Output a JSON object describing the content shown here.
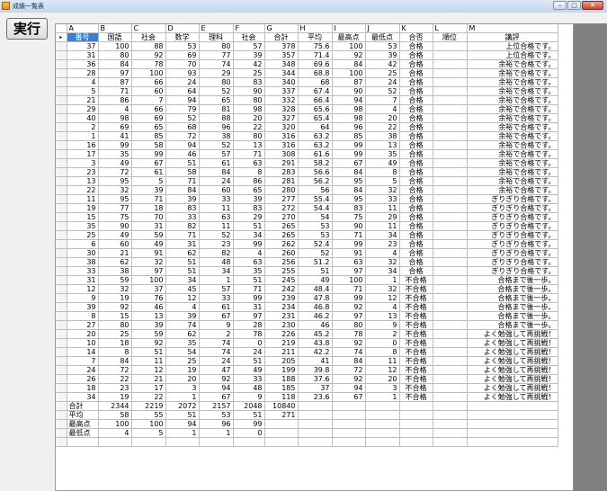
{
  "window": {
    "title": "成績一覧表",
    "min": "–",
    "max": "□",
    "close": "✕"
  },
  "run_button": "実行",
  "columns": [
    "A",
    "B",
    "C",
    "D",
    "E",
    "F",
    "G",
    "H",
    "I",
    "J",
    "K",
    "L",
    "M"
  ],
  "headers": [
    "番号",
    "国語",
    "社会",
    "数学",
    "理科",
    "社会",
    "合計",
    "平均",
    "最高点",
    "最低点",
    "合否",
    "順位",
    "講評"
  ],
  "rows": [
    [
      "37",
      "100",
      "88",
      "53",
      "80",
      "57",
      "378",
      "75.6",
      "100",
      "53",
      "合格",
      "",
      "上位合格です。"
    ],
    [
      "31",
      "80",
      "92",
      "69",
      "77",
      "39",
      "357",
      "71.4",
      "92",
      "39",
      "合格",
      "",
      "上位合格です。"
    ],
    [
      "36",
      "84",
      "78",
      "70",
      "74",
      "42",
      "348",
      "69.6",
      "84",
      "42",
      "合格",
      "",
      "余裕で合格です。"
    ],
    [
      "28",
      "97",
      "100",
      "93",
      "29",
      "25",
      "344",
      "68.8",
      "100",
      "25",
      "合格",
      "",
      "余裕で合格です。"
    ],
    [
      "4",
      "87",
      "66",
      "24",
      "80",
      "83",
      "340",
      "68",
      "87",
      "24",
      "合格",
      "",
      "余裕で合格です。"
    ],
    [
      "5",
      "71",
      "60",
      "64",
      "52",
      "90",
      "337",
      "67.4",
      "90",
      "52",
      "合格",
      "",
      "余裕で合格です。"
    ],
    [
      "21",
      "86",
      "7",
      "94",
      "65",
      "80",
      "332",
      "66.4",
      "94",
      "7",
      "合格",
      "",
      "余裕で合格です。"
    ],
    [
      "29",
      "4",
      "66",
      "79",
      "81",
      "98",
      "328",
      "65.6",
      "98",
      "4",
      "合格",
      "",
      "余裕で合格です。"
    ],
    [
      "40",
      "98",
      "69",
      "52",
      "88",
      "20",
      "327",
      "65.4",
      "98",
      "20",
      "合格",
      "",
      "余裕で合格です。"
    ],
    [
      "2",
      "69",
      "65",
      "68",
      "96",
      "22",
      "320",
      "64",
      "96",
      "22",
      "合格",
      "",
      "余裕で合格です。"
    ],
    [
      "1",
      "41",
      "85",
      "72",
      "38",
      "80",
      "316",
      "63.2",
      "85",
      "38",
      "合格",
      "",
      "余裕で合格です。"
    ],
    [
      "16",
      "99",
      "58",
      "94",
      "52",
      "13",
      "316",
      "63.2",
      "99",
      "13",
      "合格",
      "",
      "余裕で合格です。"
    ],
    [
      "17",
      "35",
      "99",
      "46",
      "57",
      "71",
      "308",
      "61.6",
      "99",
      "35",
      "合格",
      "",
      "余裕で合格です。"
    ],
    [
      "3",
      "49",
      "67",
      "51",
      "61",
      "63",
      "291",
      "58.2",
      "67",
      "49",
      "合格",
      "",
      "余裕で合格です。"
    ],
    [
      "23",
      "72",
      "61",
      "58",
      "84",
      "8",
      "283",
      "56.6",
      "84",
      "8",
      "合格",
      "",
      "余裕で合格です。"
    ],
    [
      "13",
      "95",
      "5",
      "71",
      "24",
      "86",
      "281",
      "56.2",
      "95",
      "5",
      "合格",
      "",
      "余裕で合格です。"
    ],
    [
      "22",
      "32",
      "39",
      "84",
      "60",
      "65",
      "280",
      "56",
      "84",
      "32",
      "合格",
      "",
      "余裕で合格です。"
    ],
    [
      "11",
      "95",
      "71",
      "39",
      "33",
      "39",
      "277",
      "55.4",
      "95",
      "33",
      "合格",
      "",
      "ぎりぎり合格です。"
    ],
    [
      "19",
      "77",
      "18",
      "83",
      "11",
      "83",
      "272",
      "54.4",
      "83",
      "11",
      "合格",
      "",
      "ぎりぎり合格です。"
    ],
    [
      "15",
      "75",
      "70",
      "33",
      "63",
      "29",
      "270",
      "54",
      "75",
      "29",
      "合格",
      "",
      "ぎりぎり合格です。"
    ],
    [
      "35",
      "90",
      "31",
      "82",
      "11",
      "51",
      "265",
      "53",
      "90",
      "11",
      "合格",
      "",
      "ぎりぎり合格です。"
    ],
    [
      "25",
      "49",
      "59",
      "71",
      "52",
      "34",
      "265",
      "53",
      "71",
      "34",
      "合格",
      "",
      "ぎりぎり合格です。"
    ],
    [
      "6",
      "60",
      "49",
      "31",
      "23",
      "99",
      "262",
      "52.4",
      "99",
      "23",
      "合格",
      "",
      "ぎりぎり合格です。"
    ],
    [
      "30",
      "21",
      "91",
      "62",
      "82",
      "4",
      "260",
      "52",
      "91",
      "4",
      "合格",
      "",
      "ぎりぎり合格です。"
    ],
    [
      "38",
      "62",
      "32",
      "51",
      "48",
      "63",
      "256",
      "51.2",
      "63",
      "32",
      "合格",
      "",
      "ぎりぎり合格です。"
    ],
    [
      "33",
      "38",
      "97",
      "51",
      "34",
      "35",
      "255",
      "51",
      "97",
      "34",
      "合格",
      "",
      "ぎりぎり合格です。"
    ],
    [
      "31",
      "59",
      "100",
      "34",
      "1",
      "51",
      "245",
      "49",
      "100",
      "1",
      "不合格",
      "",
      "合格まで後一歩。"
    ],
    [
      "12",
      "32",
      "37",
      "45",
      "57",
      "71",
      "242",
      "48.4",
      "71",
      "32",
      "不合格",
      "",
      "合格まで後一歩。"
    ],
    [
      "9",
      "19",
      "76",
      "12",
      "33",
      "99",
      "239",
      "47.8",
      "99",
      "12",
      "不合格",
      "",
      "合格まで後一歩。"
    ],
    [
      "39",
      "92",
      "46",
      "4",
      "61",
      "31",
      "234",
      "46.8",
      "92",
      "4",
      "不合格",
      "",
      "合格まで後一歩。"
    ],
    [
      "8",
      "15",
      "13",
      "39",
      "67",
      "97",
      "231",
      "46.2",
      "97",
      "13",
      "不合格",
      "",
      "合格まで後一歩。"
    ],
    [
      "27",
      "80",
      "39",
      "74",
      "9",
      "28",
      "230",
      "46",
      "80",
      "9",
      "不合格",
      "",
      "合格まで後一歩。"
    ],
    [
      "20",
      "25",
      "59",
      "62",
      "2",
      "78",
      "226",
      "45.2",
      "78",
      "2",
      "不合格",
      "",
      "よく勉強して再挑戦！"
    ],
    [
      "10",
      "18",
      "92",
      "35",
      "74",
      "0",
      "219",
      "43.8",
      "92",
      "0",
      "不合格",
      "",
      "よく勉強して再挑戦！"
    ],
    [
      "14",
      "8",
      "51",
      "54",
      "74",
      "24",
      "211",
      "42.2",
      "74",
      "8",
      "不合格",
      "",
      "よく勉強して再挑戦！"
    ],
    [
      "7",
      "84",
      "11",
      "25",
      "24",
      "51",
      "205",
      "41",
      "84",
      "11",
      "不合格",
      "",
      "よく勉強して再挑戦！"
    ],
    [
      "24",
      "72",
      "12",
      "19",
      "47",
      "49",
      "199",
      "39.8",
      "72",
      "12",
      "不合格",
      "",
      "よく勉強して再挑戦！"
    ],
    [
      "26",
      "22",
      "21",
      "20",
      "92",
      "33",
      "188",
      "37.6",
      "92",
      "20",
      "不合格",
      "",
      "よく勉強して再挑戦！"
    ],
    [
      "18",
      "23",
      "17",
      "3",
      "94",
      "48",
      "185",
      "37",
      "94",
      "3",
      "不合格",
      "",
      "よく勉強して再挑戦！"
    ],
    [
      "34",
      "19",
      "22",
      "1",
      "67",
      "9",
      "118",
      "23.6",
      "67",
      "1",
      "不合格",
      "",
      "よく勉強して再挑戦！"
    ]
  ],
  "summary": [
    [
      "合計",
      "2344",
      "2219",
      "2072",
      "2157",
      "2048",
      "10840",
      "",
      "",
      "",
      "",
      "",
      ""
    ],
    [
      "平均",
      "58",
      "55",
      "51",
      "53",
      "51",
      "271",
      "",
      "",
      "",
      "",
      "",
      ""
    ],
    [
      "最高点",
      "100",
      "100",
      "94",
      "96",
      "99",
      "",
      "",
      "",
      "",
      "",
      "",
      ""
    ],
    [
      "最低点",
      "4",
      "5",
      "1",
      "1",
      "0",
      "",
      "",
      "",
      "",
      "",
      "",
      ""
    ],
    [
      "",
      "",
      "",
      "",
      "",
      "",
      "",
      "",
      "",
      "",
      "",
      "",
      ""
    ]
  ],
  "colors": {
    "selection": "#3a7fd6",
    "dark_area": "#808080"
  }
}
